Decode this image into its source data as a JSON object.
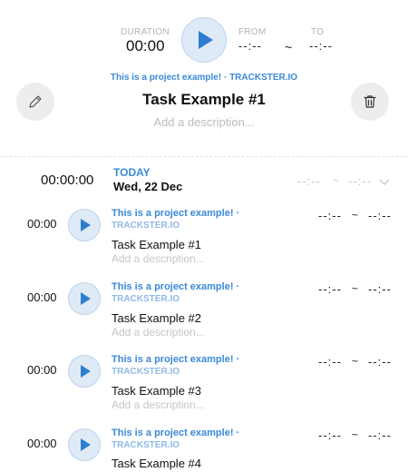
{
  "header": {
    "duration_label": "DURATION",
    "duration_value": "00:00",
    "from_label": "FROM",
    "from_value": "--:--",
    "range_separator": "~",
    "to_label": "TO",
    "to_value": "--:--",
    "project_name": "This is a project example!",
    "project_separator": "·",
    "project_owner": "TRACKSTER.IO",
    "task_title": "Task Example #1",
    "description_placeholder": "Add a description...",
    "edit_icon": "pencil-icon",
    "delete_icon": "trash-icon"
  },
  "day": {
    "total": "00:00:00",
    "label": "TODAY",
    "date": "Wed, 22 Dec",
    "from": "--:--",
    "separator": "~",
    "to": "--:--",
    "toggle_icon": "chevron-down-icon"
  },
  "entries": [
    {
      "duration": "00:00",
      "project": "This is a project example! ·",
      "owner": "TRACKSTER.IO",
      "title": "Task Example #1",
      "description": "Add a description...",
      "from": "--:--",
      "sep": "~",
      "to": "--:--"
    },
    {
      "duration": "00:00",
      "project": "This is a project example! ·",
      "owner": "TRACKSTER.IO",
      "title": "Task Example #2",
      "description": "Add a description...",
      "from": "--:--",
      "sep": "~",
      "to": "--:--"
    },
    {
      "duration": "00:00",
      "project": "This is a project example! ·",
      "owner": "TRACKSTER.IO",
      "title": "Task Example #3",
      "description": "Add a description...",
      "from": "--:--",
      "sep": "~",
      "to": "--:--"
    },
    {
      "duration": "00:00",
      "project": "This is a project example! ·",
      "owner": "TRACKSTER.IO",
      "title": "Task Example #4",
      "description": "",
      "from": "--:--",
      "sep": "~",
      "to": "--:--"
    }
  ],
  "colors": {
    "accent": "#2d7ed0",
    "accent_bg": "#deeaf6",
    "link": "#3a8ad6"
  }
}
